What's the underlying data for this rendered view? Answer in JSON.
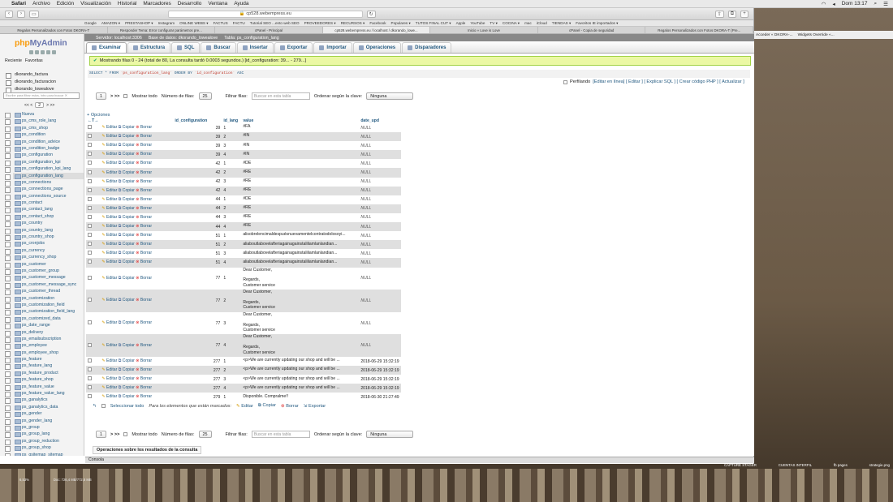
{
  "menubar": {
    "items": [
      "Safari",
      "Archivo",
      "Edición",
      "Visualización",
      "Historial",
      "Marcadores",
      "Desarrollo",
      "Ventana",
      "Ayuda"
    ],
    "clock": "Dom 13:17"
  },
  "browser": {
    "url": "cp528.webempress.eu"
  },
  "bookmarks": [
    "Google",
    "AMAZON ▾",
    "PRESTASHOP ▾",
    "Instagram",
    "ONLINE WEBS ▾",
    "FACTUS",
    "FACTU",
    "Tutorial SEO ...ento web SEO",
    "PROVEEDORES ▾",
    "RECURSOS ▾",
    "Facebook",
    "Populares ▾",
    "TUTOS FINAL CUT ▾",
    "Apple",
    "YouTube",
    "TV ▾",
    "COCINA ▾",
    "mac",
    "iCloud",
    "TIENDAS ▾",
    "Favoritos IE importados ▾"
  ],
  "tabs": [
    "Regalos Personalizados con Fotos DKORA-T",
    "Responder Tema: Error configurar parámetros pre...",
    "cPanel - Principal",
    "cp528.webempress.eu / localhost / dkorando_lowe...",
    "Inicio » Love is Love",
    "cPanel - Copia de seguridad",
    "Regalos Personalizados con Fotos DKORA-T (Pre..."
  ],
  "rightwin": {
    "a": "Acceder « DKORA-...",
    "b": "Widgets Override «..."
  },
  "sidebar": {
    "logo_a": "php",
    "logo_b": "MyAdmin",
    "links": [
      "Reciente",
      "Favoritas"
    ],
    "databases": [
      "dkorando_factura",
      "dkorando_facturacion",
      "dkorando_lowealove"
    ],
    "filter_placeholder": "Escribe para filtrar estos, intro para buscar ✕",
    "pager": {
      "prev": "<< <",
      "page": "2",
      "next": "> >>"
    },
    "new_label": "Nueva",
    "tables": [
      "ps_cms_role_lang",
      "ps_cms_shop",
      "ps_condition",
      "ps_condition_advice",
      "ps_condition_badge",
      "ps_configuration",
      "ps_configuration_kpi",
      "ps_configuration_kpi_lang",
      "ps_configuration_lang",
      "ps_connections",
      "ps_connections_page",
      "ps_connections_source",
      "ps_contact",
      "ps_contact_lang",
      "ps_contact_shop",
      "ps_country",
      "ps_country_lang",
      "ps_country_shop",
      "ps_cronjobs",
      "ps_currency",
      "ps_currency_shop",
      "ps_customer",
      "ps_customer_group",
      "ps_customer_message",
      "ps_customer_message_sync",
      "ps_customer_thread",
      "ps_customization",
      "ps_customization_field",
      "ps_customization_field_lang",
      "ps_customized_data",
      "ps_date_range",
      "ps_delivery",
      "ps_emailsubscription",
      "ps_employee",
      "ps_employee_shop",
      "ps_feature",
      "ps_feature_lang",
      "ps_feature_product",
      "ps_feature_shop",
      "ps_feature_value",
      "ps_feature_value_lang",
      "ps_ganalytics",
      "ps_ganalytics_data",
      "ps_gender",
      "ps_gender_lang",
      "ps_group",
      "ps_group_lang",
      "ps_group_reduction",
      "ps_group_shop",
      "ps_gsitemap_sitemap"
    ],
    "current_table": "ps_configuration_lang"
  },
  "breadcrumb": {
    "server": "Servidor: localhost:3306",
    "db": "Base de datos: dkorando_lowealove",
    "table": "Tabla: ps_configuration_lang"
  },
  "menu_tabs": [
    "Examinar",
    "Estructura",
    "SQL",
    "Buscar",
    "Insertar",
    "Exportar",
    "Importar",
    "Operaciones",
    "Disparadores"
  ],
  "success": "Mostrando filas 0 - 24 (total de 80, La consulta tardó 0.0003 segundos.) [id_configuration: 39... - 279...]",
  "sql": {
    "a": "SELECT * FROM ",
    "b": "`ps_configuration_lang`",
    "c": " ORDER BY ",
    "d": "`id_configuration`",
    "e": " ASC"
  },
  "profiling": {
    "label": "Perfilando",
    "links": "[Editar en línea] [ Editar ] [ Explicar SQL ] [ Crear código PHP ] [ Actualizar ]"
  },
  "nav": {
    "page": "1",
    "next": "> >>",
    "show_all": "Mostrar todo",
    "rows_label": "Número de filas:",
    "rows": "25",
    "filter_label": "Filtrar filas:",
    "filter_placeholder": "Buscar en esta tabla",
    "sort_label": "Ordenar según la clave:",
    "sort": "Ninguna"
  },
  "options": "+ Opciones",
  "columns": {
    "arrows": "←T→",
    "id_configuration": "id_configuration",
    "id_lang": "id_lang",
    "value": "value",
    "date_upd": "date_upd"
  },
  "actions": {
    "edit": "Editar",
    "copy": "Copiar",
    "delete": "Borrar"
  },
  "rows": [
    {
      "id": "39",
      "lang": "1",
      "value": "#FA",
      "date": "NULL"
    },
    {
      "id": "39",
      "lang": "2",
      "value": "#IN",
      "date": "NULL"
    },
    {
      "id": "39",
      "lang": "3",
      "value": "#IN",
      "date": "NULL"
    },
    {
      "id": "39",
      "lang": "4",
      "value": "#IN",
      "date": "NULL"
    },
    {
      "id": "42",
      "lang": "1",
      "value": "#DE",
      "date": "NULL"
    },
    {
      "id": "42",
      "lang": "2",
      "value": "#RE",
      "date": "NULL"
    },
    {
      "id": "42",
      "lang": "3",
      "value": "#RE",
      "date": "NULL"
    },
    {
      "id": "42",
      "lang": "4",
      "value": "#RE",
      "date": "NULL"
    },
    {
      "id": "44",
      "lang": "1",
      "value": "#DE",
      "date": "NULL"
    },
    {
      "id": "44",
      "lang": "2",
      "value": "#RE",
      "date": "NULL"
    },
    {
      "id": "44",
      "lang": "3",
      "value": "#RE",
      "date": "NULL"
    },
    {
      "id": "44",
      "lang": "4",
      "value": "#RE",
      "date": "NULL"
    },
    {
      "id": "51",
      "lang": "1",
      "value": "alisobrelencimaldespuésnuevamentelcontratodolosoyi...",
      "date": "NULL"
    },
    {
      "id": "51",
      "lang": "2",
      "value": "aliaboutlabovelafteriagainagainstaliliamlanlandian...",
      "date": "NULL"
    },
    {
      "id": "51",
      "lang": "3",
      "value": "aliaboutlabovelafteriagainagainstaliliamlanlandian...",
      "date": "NULL"
    },
    {
      "id": "51",
      "lang": "4",
      "value": "aliaboutlabovelafteriagainagainstaliliamlanlandian...",
      "date": "NULL"
    },
    {
      "id": "77",
      "lang": "1",
      "value": "Dear Customer,\n\nRegards,\nCustomer service",
      "date": "NULL",
      "tall": true
    },
    {
      "id": "77",
      "lang": "2",
      "value": "Dear Customer,\n\nRegards,\nCustomer service",
      "date": "NULL",
      "tall": true
    },
    {
      "id": "77",
      "lang": "3",
      "value": "Dear Customer,\n\nRegards,\nCustomer service",
      "date": "NULL",
      "tall": true
    },
    {
      "id": "77",
      "lang": "4",
      "value": "Dear Customer,\n\nRegards,\nCustomer service",
      "date": "NULL",
      "tall": true
    },
    {
      "id": "277",
      "lang": "1",
      "value": "<p>We are currently updating our shop and will be ...",
      "date": "2018-06-29 15:32:19"
    },
    {
      "id": "277",
      "lang": "2",
      "value": "<p>We are currently updating our shop and will be ...",
      "date": "2018-06-29 15:32:19"
    },
    {
      "id": "277",
      "lang": "3",
      "value": "<p>We are currently updating our shop and will be ...",
      "date": "2018-06-29 15:32:19"
    },
    {
      "id": "277",
      "lang": "4",
      "value": "<p>We are currently updating our shop and will be ...",
      "date": "2018-06-29 15:32:19"
    },
    {
      "id": "279",
      "lang": "1",
      "value": "Disponible. Compralme!!",
      "date": "2018-06-30 21:27:49"
    }
  ],
  "bulk": {
    "select_all": "Seleccionar todo",
    "marked": "Para los elementos que están marcados:",
    "edit": "Editar",
    "copy": "Copiar",
    "delete": "Borrar",
    "export": "Exportar"
  },
  "ops_label": "Operaciones sobre los resultados de la consulta",
  "console": "Consola",
  "desktop": {
    "a": "CAPTURE STAGER",
    "b": "CUENTAS INTERFIL",
    "c": "fb pages",
    "d": "strategie.png"
  },
  "status": {
    "a": "6,53%",
    "b": "Doc: 726,4 MB/772,8 MB"
  }
}
